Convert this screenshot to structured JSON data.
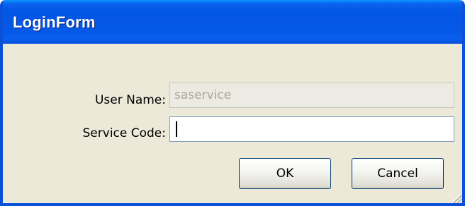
{
  "window": {
    "title": "LoginForm"
  },
  "form": {
    "user_name_label": "User Name:",
    "user_name_value": "saservice",
    "service_code_label": "Service Code:",
    "service_code_value": ""
  },
  "buttons": {
    "ok_label": "OK",
    "cancel_label": "Cancel"
  },
  "colors": {
    "title_bar": "#0458e6",
    "window_bg": "#ece9d8",
    "disabled_text": "#a8a796"
  },
  "icons": {
    "resize_grip": "resize-grip-icon"
  }
}
